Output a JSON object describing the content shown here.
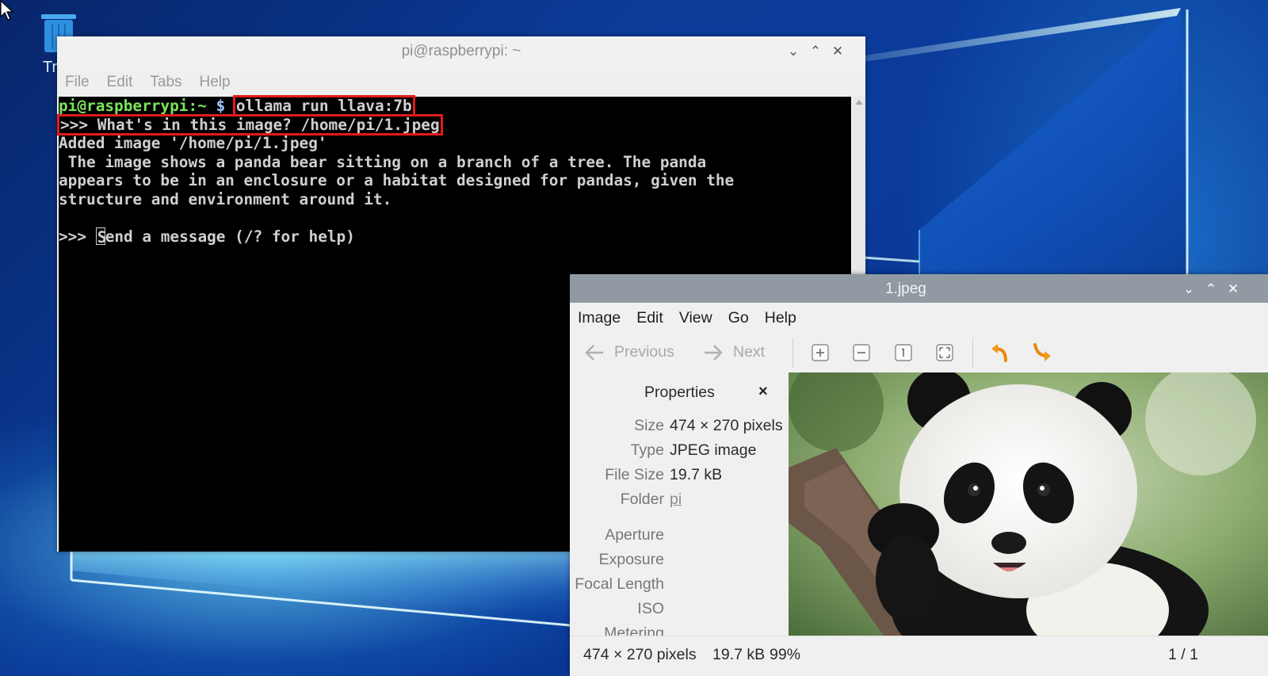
{
  "desktop": {
    "trash_label": "Tr"
  },
  "terminal": {
    "title": "pi@raspberrypi: ~",
    "menu": [
      "File",
      "Edit",
      "Tabs",
      "Help"
    ],
    "prompt_user": "pi@raspberrypi:~",
    "prompt_dollar": "$",
    "command": "ollama run llava:7b",
    "question": ">>> What's in this image? /home/pi/1.jpeg",
    "output": [
      "Added image '/home/pi/1.jpeg'",
      " The image shows a panda bear sitting on a branch of a tree. The panda",
      "appears to be in an enclosure or a habitat designed for pandas, given the",
      "structure and environment around it."
    ],
    "input_prefix": ">>> ",
    "cursor_char": "S",
    "input_placeholder": "end a message (/? for help)",
    "highlight_color": "#e21b1b"
  },
  "viewer": {
    "title": "1.jpeg",
    "menu": [
      "Image",
      "Edit",
      "View",
      "Go",
      "Help"
    ],
    "toolbar": {
      "previous_label": "Previous",
      "next_label": "Next",
      "icons": [
        "zoom-in-icon",
        "zoom-out-icon",
        "zoom-normal-icon",
        "zoom-fit-icon",
        "rotate-left-icon",
        "rotate-right-icon"
      ]
    },
    "properties": {
      "title": "Properties",
      "close": "×",
      "rows": [
        {
          "key": "Size",
          "value": "474 × 270 pixels"
        },
        {
          "key": "Type",
          "value": "JPEG image"
        },
        {
          "key": "File Size",
          "value": "19.7 kB"
        },
        {
          "key": "Folder",
          "value": "pi"
        },
        {
          "key": "Aperture",
          "value": ""
        },
        {
          "key": "Exposure",
          "value": ""
        },
        {
          "key": "Focal Length",
          "value": ""
        },
        {
          "key": "ISO",
          "value": ""
        },
        {
          "key": "Metering",
          "value": ""
        }
      ]
    },
    "status": {
      "dimensions": "474 × 270 pixels",
      "file_size": "19.7 kB",
      "zoom": "99%",
      "position": "1 / 1"
    }
  }
}
